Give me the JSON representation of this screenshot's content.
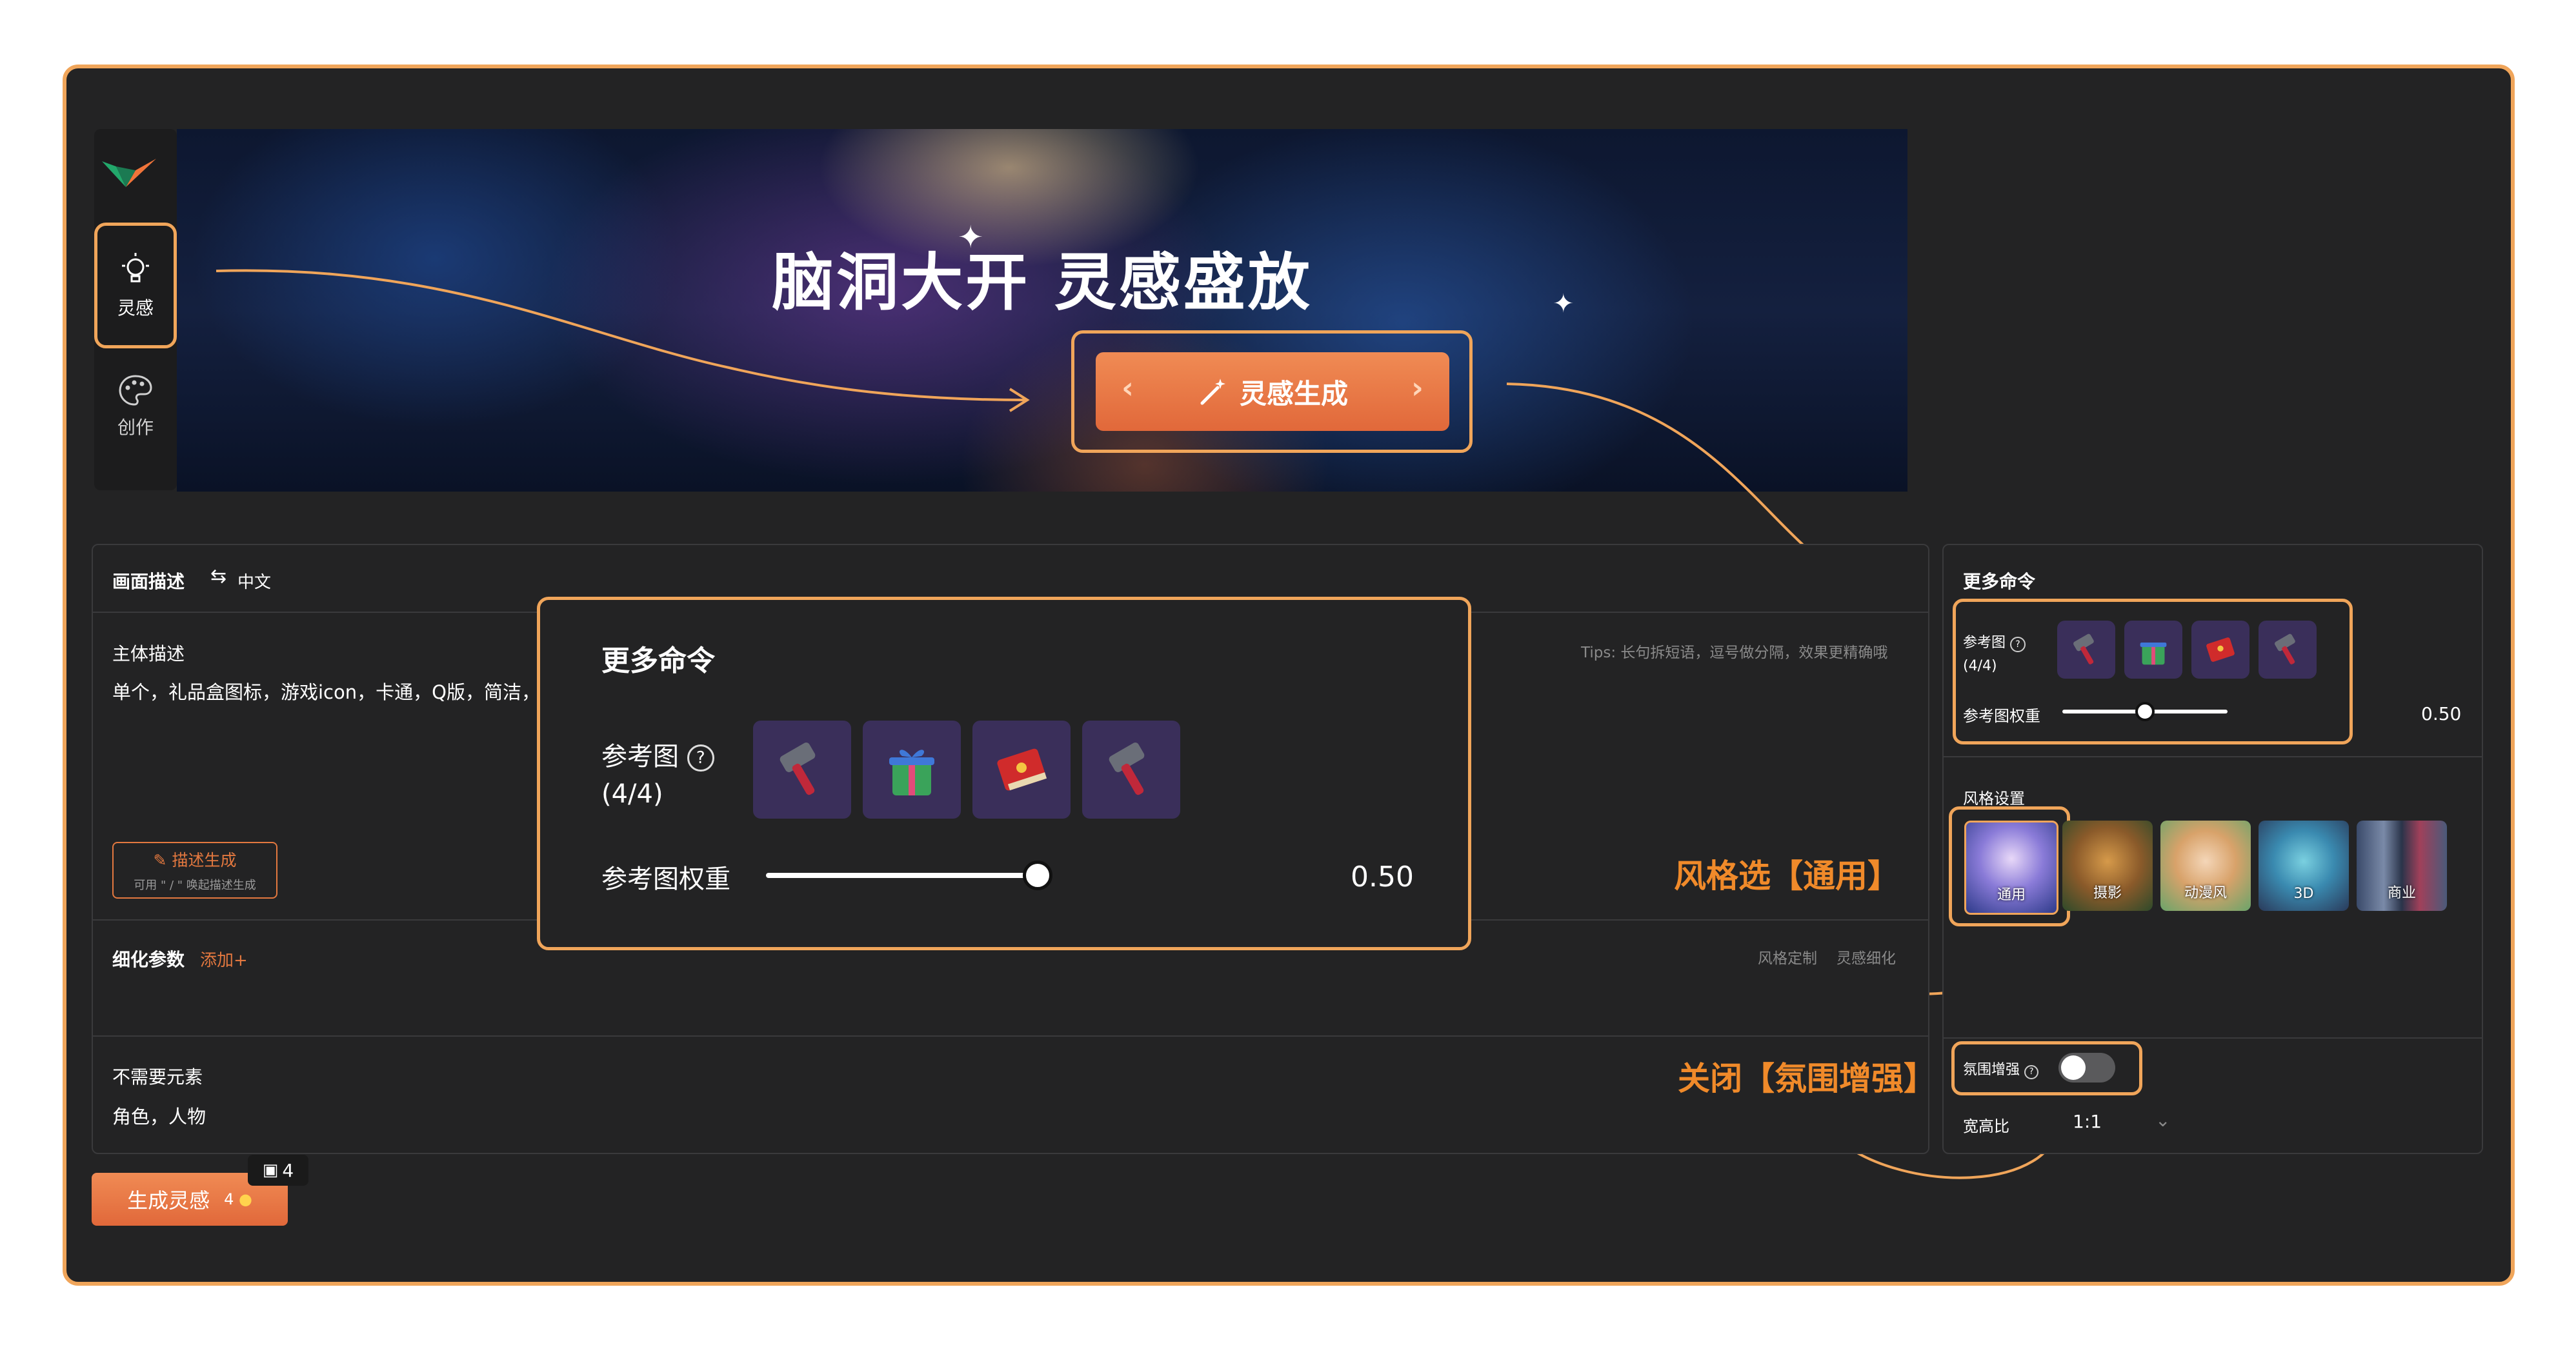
{
  "nav": {
    "items": [
      {
        "label": "灵感",
        "icon": "lightbulb-icon",
        "active": true
      },
      {
        "label": "创作",
        "icon": "palette-icon",
        "active": false
      }
    ]
  },
  "banner": {
    "title": "脑洞大开 灵感盛放",
    "generate_button": "灵感生成"
  },
  "description": {
    "header": "画面描述",
    "lang_toggle": "中文",
    "subject_label": "主体描述",
    "subject_value": "单个，礼品盒图标，游戏icon，卡通，Q版，简洁，简",
    "tips": "Tips: 长句拆短语，逗号做分隔，效果更精确哦",
    "describe_button": "描述生成",
    "describe_hint": "可用 \" / \" 唤起描述生成"
  },
  "refine": {
    "label": "细化参数",
    "add": "添加+",
    "tag1": "风格定制",
    "tag2": "灵感细化"
  },
  "negative": {
    "label": "不需要元素",
    "value": "角色，人物"
  },
  "generate": {
    "label": "生成灵感",
    "cost": "4",
    "badge_count": "4"
  },
  "popup": {
    "title": "更多命令",
    "ref_label": "参考图",
    "ref_count": "(4/4)",
    "weight_label": "参考图权重",
    "weight_value": "0.50",
    "ref_items": [
      "hammer-icon",
      "gift-box-icon",
      "red-book-icon",
      "hammer-icon"
    ]
  },
  "right_panel": {
    "title": "更多命令",
    "ref_label": "参考图",
    "ref_count": "(4/4)",
    "weight_label": "参考图权重",
    "weight_value": "0.50",
    "weight": 0.5,
    "style_label": "风格设置",
    "styles": [
      "通用",
      "摄影",
      "动漫风",
      "3D",
      "商业"
    ],
    "ambience_label": "氛围增强",
    "ambience_on": false,
    "ratio_label": "宽高比",
    "ratio_value": "1:1"
  },
  "annotations": {
    "style": "风格选【通用】",
    "ambience": "关闭【氛围增强】"
  },
  "colors": {
    "accent": "#f0a55a",
    "button": "#e1683a",
    "bg": "#232324"
  }
}
